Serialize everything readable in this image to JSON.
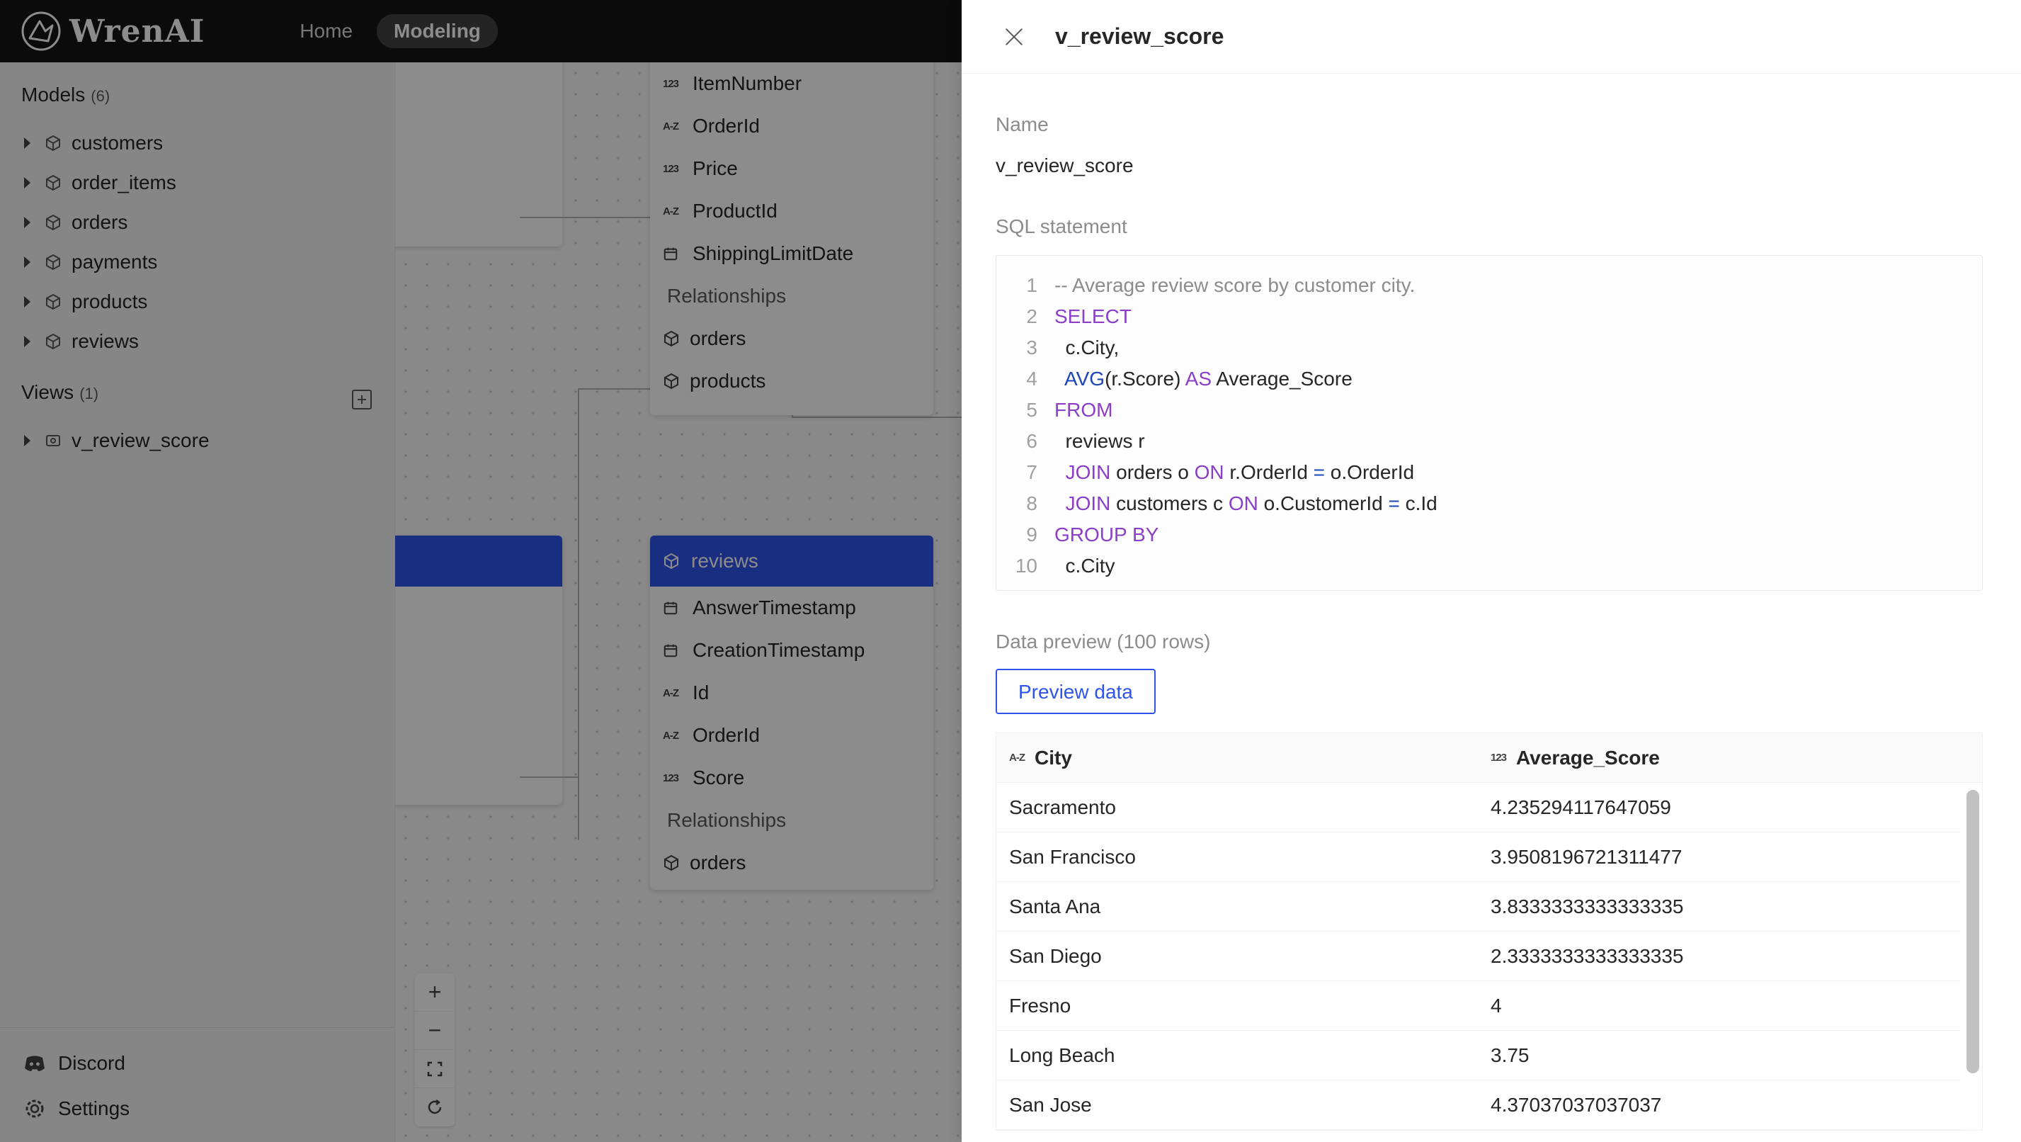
{
  "app": {
    "name": "WrenAI"
  },
  "nav": {
    "home": "Home",
    "modeling": "Modeling"
  },
  "sidebar": {
    "models_label": "Models",
    "models_count": "(6)",
    "models": [
      "customers",
      "order_items",
      "orders",
      "payments",
      "products",
      "reviews"
    ],
    "views_label": "Views",
    "views_count": "(1)",
    "views": [
      "v_review_score"
    ],
    "discord": "Discord",
    "settings": "Settings"
  },
  "canvas": {
    "order_items_fields": [
      {
        "type": "123",
        "name": "ItemNumber"
      },
      {
        "type": "A-Z",
        "name": "OrderId"
      },
      {
        "type": "123",
        "name": "Price"
      },
      {
        "type": "A-Z",
        "name": "ProductId"
      },
      {
        "type": "date",
        "name": "ShippingLimitDate"
      }
    ],
    "relationships_label": "Relationships",
    "order_items_rels": [
      "orders",
      "products"
    ],
    "reviews_title": "reviews",
    "reviews_fields": [
      {
        "type": "date",
        "name": "AnswerTimestamp"
      },
      {
        "type": "date",
        "name": "CreationTimestamp"
      },
      {
        "type": "A-Z",
        "name": "Id"
      },
      {
        "type": "A-Z",
        "name": "OrderId"
      },
      {
        "type": "123",
        "name": "Score"
      }
    ],
    "reviews_rels": [
      "orders"
    ],
    "zoom": {
      "plus": "+",
      "minus": "−"
    }
  },
  "drawer": {
    "title": "v_review_score",
    "name_label": "Name",
    "name_value": "v_review_score",
    "sql_label": "SQL statement",
    "sql_lines": [
      {
        "n": "1",
        "c": "-- Average review score by customer city."
      },
      {
        "n": "2",
        "c": "SELECT"
      },
      {
        "n": "3",
        "c": "  c.City,"
      },
      {
        "n": "4",
        "c": "  AVG(r.Score) AS Average_Score"
      },
      {
        "n": "5",
        "c": "FROM"
      },
      {
        "n": "6",
        "c": "  reviews r"
      },
      {
        "n": "7",
        "c": "  JOIN orders o ON r.OrderId = o.OrderId"
      },
      {
        "n": "8",
        "c": "  JOIN customers c ON o.CustomerId = c.Id"
      },
      {
        "n": "9",
        "c": "GROUP BY"
      },
      {
        "n": "10",
        "c": "  c.City"
      }
    ],
    "preview_label": "Data preview (100 rows)",
    "preview_button": "Preview data",
    "columns": [
      {
        "type": "A-Z",
        "name": "City"
      },
      {
        "type": "123",
        "name": "Average_Score"
      }
    ],
    "rows": [
      [
        "Sacramento",
        "4.235294117647059"
      ],
      [
        "San Francisco",
        "3.9508196721311477"
      ],
      [
        "Santa Ana",
        "3.8333333333333335"
      ],
      [
        "San Diego",
        "2.3333333333333335"
      ],
      [
        "Fresno",
        "4"
      ],
      [
        "Long Beach",
        "3.75"
      ],
      [
        "San Jose",
        "4.37037037037037"
      ]
    ]
  },
  "colors": {
    "accent": "#2f54eb",
    "header_bg": "#141414",
    "sql_keyword": "#8b3fc6",
    "sql_function": "#1c46b8"
  }
}
